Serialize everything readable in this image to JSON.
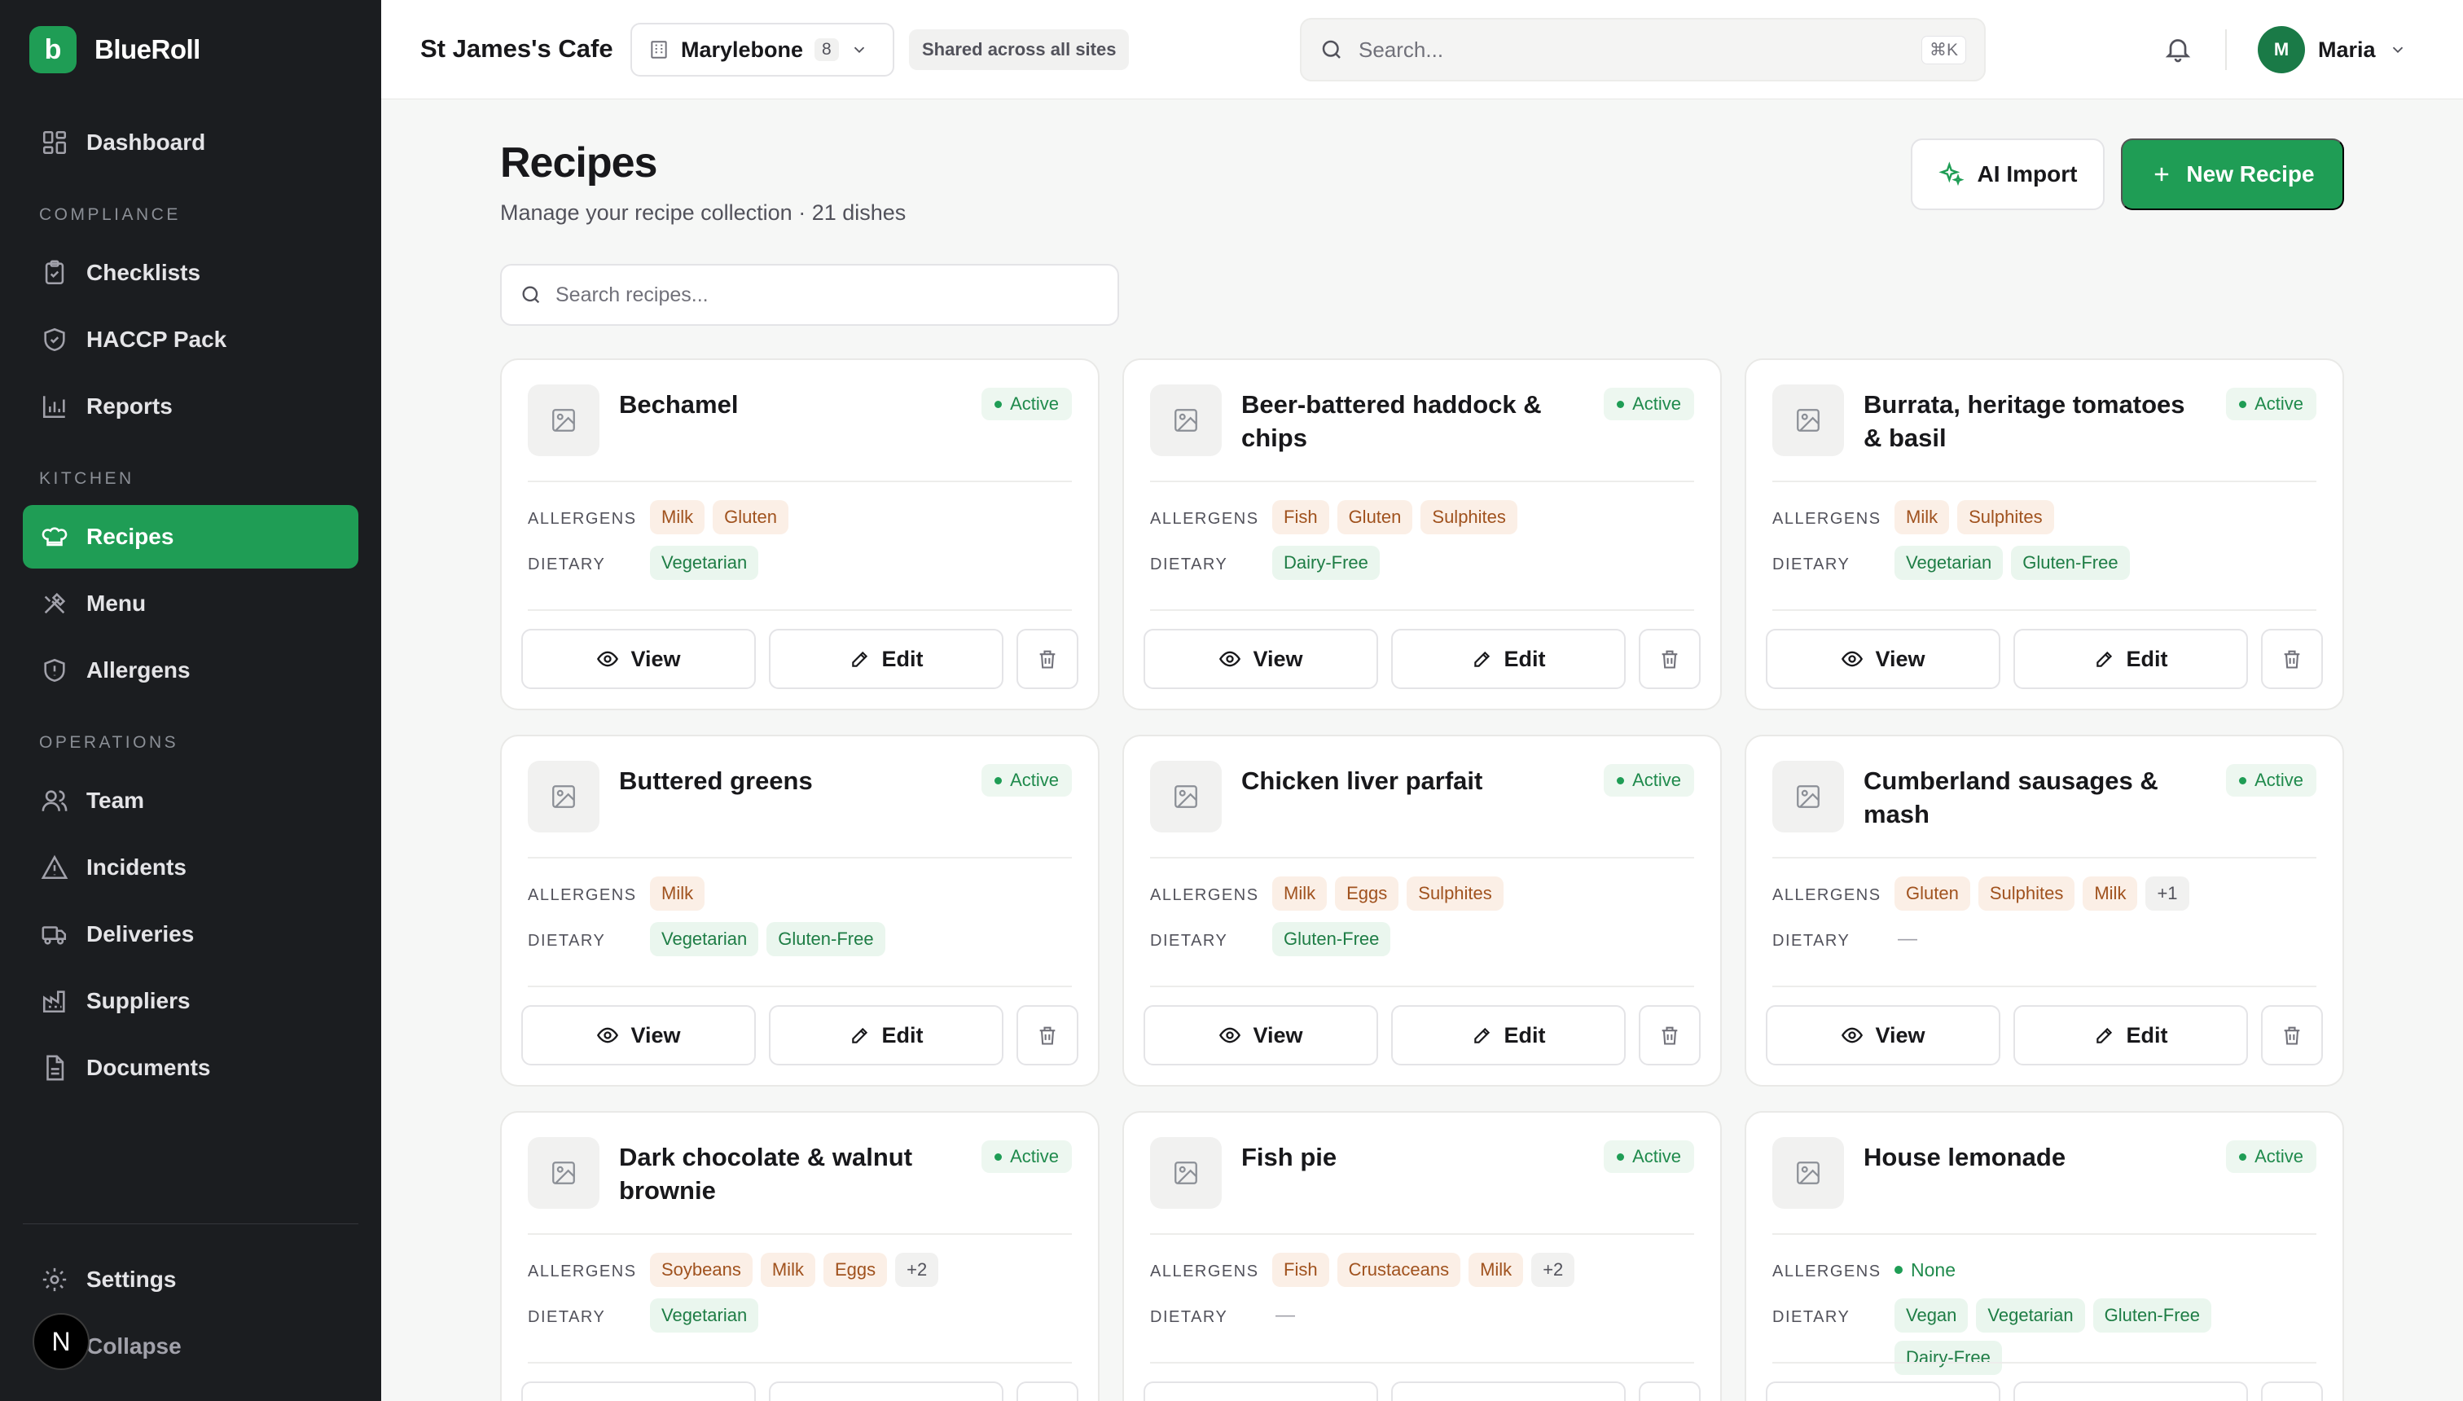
{
  "brand": {
    "logo_letter": "b",
    "name": "BlueRoll"
  },
  "sidebar": {
    "top": [
      {
        "label": "Dashboard",
        "icon": "dashboard-icon"
      }
    ],
    "sections": [
      {
        "title": "COMPLIANCE",
        "items": [
          {
            "label": "Checklists",
            "icon": "clipboard-icon"
          },
          {
            "label": "HACCP Pack",
            "icon": "shield-check-icon"
          },
          {
            "label": "Reports",
            "icon": "bar-chart-icon"
          }
        ]
      },
      {
        "title": "KITCHEN",
        "items": [
          {
            "label": "Recipes",
            "icon": "chef-hat-icon",
            "active": true
          },
          {
            "label": "Menu",
            "icon": "utensils-icon"
          },
          {
            "label": "Allergens",
            "icon": "shield-alert-icon"
          }
        ]
      },
      {
        "title": "OPERATIONS",
        "items": [
          {
            "label": "Team",
            "icon": "users-icon"
          },
          {
            "label": "Incidents",
            "icon": "alert-triangle-icon"
          },
          {
            "label": "Deliveries",
            "icon": "truck-icon"
          },
          {
            "label": "Suppliers",
            "icon": "factory-icon"
          },
          {
            "label": "Documents",
            "icon": "file-icon"
          }
        ]
      }
    ],
    "bottom": [
      {
        "label": "Settings",
        "icon": "gear-icon"
      },
      {
        "label": "Collapse",
        "icon": "collapse-icon"
      }
    ],
    "overlay_badge": "N"
  },
  "topbar": {
    "cafe_name": "St James's Cafe",
    "site": {
      "label": "Marylebone",
      "count": "8"
    },
    "shared_badge": "Shared across all sites",
    "search": {
      "placeholder": "Search...",
      "shortcut": "⌘K"
    },
    "user": {
      "initial": "M",
      "name": "Maria"
    }
  },
  "page": {
    "title": "Recipes",
    "subtitle": "Manage your recipe collection · 21 dishes",
    "ai_import_label": "AI Import",
    "new_recipe_label": "New Recipe",
    "search_placeholder": "Search recipes..."
  },
  "labels": {
    "allergens": "ALLERGENS",
    "dietary": "DIETARY",
    "view": "View",
    "edit": "Edit",
    "none": "None",
    "empty": "—"
  },
  "recipes": [
    {
      "name": "Bechamel",
      "status": "Active",
      "allergens": [
        "Milk",
        "Gluten"
      ],
      "dietary": [
        "Vegetarian"
      ]
    },
    {
      "name": "Beer-battered haddock & chips",
      "status": "Active",
      "allergens": [
        "Fish",
        "Gluten",
        "Sulphites"
      ],
      "dietary": [
        "Dairy-Free"
      ]
    },
    {
      "name": "Burrata, heritage tomatoes & basil",
      "status": "Active",
      "allergens": [
        "Milk",
        "Sulphites"
      ],
      "dietary": [
        "Vegetarian",
        "Gluten-Free"
      ]
    },
    {
      "name": "Buttered greens",
      "status": "Active",
      "allergens": [
        "Milk"
      ],
      "dietary": [
        "Vegetarian",
        "Gluten-Free"
      ]
    },
    {
      "name": "Chicken liver parfait",
      "status": "Active",
      "allergens": [
        "Milk",
        "Eggs",
        "Sulphites"
      ],
      "dietary": [
        "Gluten-Free"
      ]
    },
    {
      "name": "Cumberland sausages & mash",
      "status": "Active",
      "allergens": [
        "Gluten",
        "Sulphites",
        "Milk"
      ],
      "allergens_more": "+1",
      "dietary": []
    },
    {
      "name": "Dark chocolate & walnut brownie",
      "status": "Active",
      "allergens": [
        "Soybeans",
        "Milk",
        "Eggs"
      ],
      "allergens_more": "+2",
      "dietary": [
        "Vegetarian"
      ]
    },
    {
      "name": "Fish pie",
      "status": "Active",
      "allergens": [
        "Fish",
        "Crustaceans",
        "Milk"
      ],
      "allergens_more": "+2",
      "dietary": []
    },
    {
      "name": "House lemonade",
      "status": "Active",
      "allergens": [],
      "dietary": [
        "Vegan",
        "Vegetarian",
        "Gluten-Free",
        "Dairy-Free"
      ]
    }
  ],
  "colors": {
    "brand_green": "#1f9d55",
    "sidebar_bg": "#1b1d20",
    "allergen_text": "#a0521e",
    "dietary_text": "#1e7d45"
  }
}
